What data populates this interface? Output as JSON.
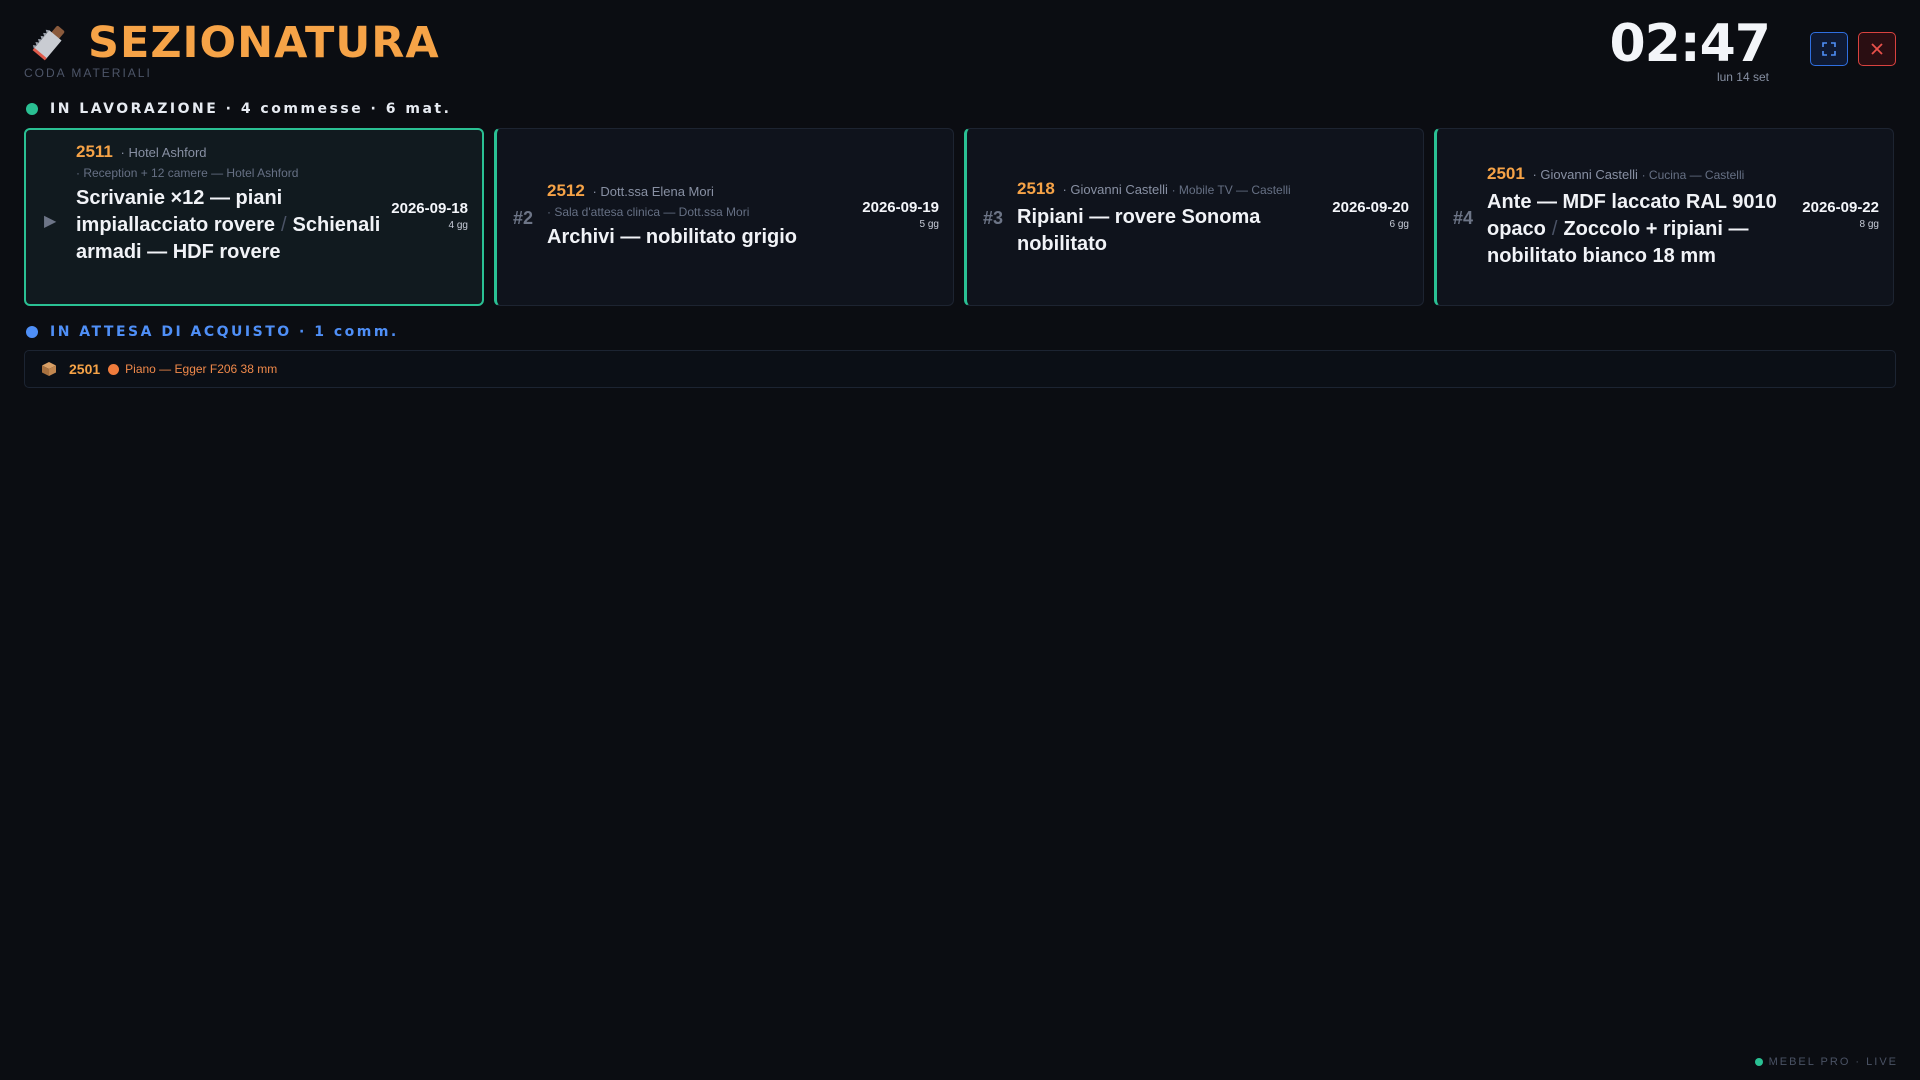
{
  "header": {
    "title": "SEZIONATURA",
    "subtitle": "CODA MATERIALI",
    "clock": "02:47",
    "date": "lun 14 set",
    "logo_icon": "saw-icon",
    "expand_icon": "fullscreen-icon",
    "close_icon": "close-icon"
  },
  "sections": {
    "working": "IN LAVORAZIONE · 4 commesse · 6 mat.",
    "waiting": "IN ATTESA DI ACQUISTO · 1 comm."
  },
  "cards": [
    {
      "marker": "▶",
      "id": "2511",
      "client": "· Hotel Ashford",
      "project": "· Reception + 12 camere — Hotel Ashford",
      "title_a": "Scrivanie ×12 — piani impiallacciato rovere",
      "sep": "/",
      "title_b": "Schienali armadi — HDF rovere",
      "date": "2026-09-18",
      "days": "4 gg"
    },
    {
      "marker": "#2",
      "id": "2512",
      "client": "· Dott.ssa Elena Mori",
      "project": "· Sala d'attesa clinica — Dott.ssa Mori",
      "title_a": "Archivi — nobilitato grigio",
      "date": "2026-09-19",
      "days": "5 gg"
    },
    {
      "marker": "#3",
      "id": "2518",
      "client": "· Giovanni Castelli",
      "project": "· Mobile TV — Castelli",
      "title_a": "Ripiani — rovere Sonoma nobilitato",
      "date": "2026-09-20",
      "days": "6 gg"
    },
    {
      "marker": "#4",
      "id": "2501",
      "client": "· Giovanni Castelli",
      "project": "· Cucina — Castelli",
      "title_a": "Ante — MDF laccato RAL 9010 opaco",
      "sep": "/",
      "title_b": "Zoccolo + ripiani — nobilitato bianco 18 mm",
      "date": "2026-09-22",
      "days": "8 gg"
    }
  ],
  "waiting": {
    "icon": "box-icon",
    "id": "2501",
    "text": "Piano — Egger F206 38 mm"
  },
  "footer": {
    "label": "MEBEL PRO · LIVE"
  },
  "colors": {
    "accent": "#f6a347",
    "active": "#2ac093",
    "waiting": "#4f8ff7",
    "alert": "#f07c3c"
  }
}
